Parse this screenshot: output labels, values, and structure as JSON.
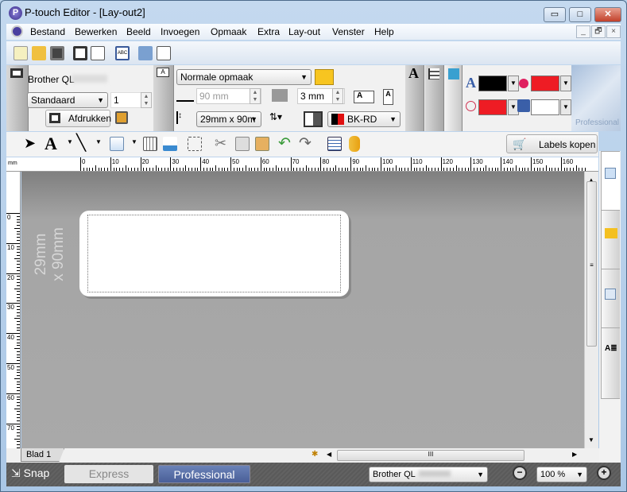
{
  "window": {
    "title": "P-touch Editor - [Lay-out2]",
    "minimize": "▭",
    "maximize": "□",
    "close": "✕"
  },
  "menu": {
    "items": [
      "Bestand",
      "Bewerken",
      "Beeld",
      "Invoegen",
      "Opmaak",
      "Extra",
      "Lay-out",
      "Venster",
      "Help"
    ],
    "mdi": [
      "_",
      "🗗",
      "×"
    ]
  },
  "toolbar": {
    "icons": [
      "new-layout-icon",
      "open-icon",
      "save-icon",
      "print-icon",
      "print-preview-icon",
      "text-label-icon",
      "database-icon",
      "transfer-icon"
    ]
  },
  "printer_panel": {
    "printer": "Brother QL",
    "mode": "Standaard",
    "copies": "1",
    "print_button": "Afdrukken"
  },
  "layout_panel": {
    "style": "Normale opmaak",
    "length": "90 mm",
    "margin": "3 mm",
    "tape_size": "29mm x 90m",
    "tape_color": "BK-RD"
  },
  "color_panel": {
    "text_color": "#000000",
    "fill_color": "#ee1c24",
    "line_color": "#ee1c24",
    "bg_color": "#ffffff",
    "brand": "Professional"
  },
  "draw_toolbar": {
    "icons": [
      "select-arrow-icon",
      "text-icon",
      "line-icon",
      "rectangle-icon",
      "table-icon",
      "barcode-icon",
      "arrange-icon",
      "cut-icon",
      "copy-icon",
      "paste-icon",
      "undo-icon",
      "redo-icon",
      "properties-icon",
      "database-icon"
    ],
    "buy_labels": "Labels kopen"
  },
  "ruler": {
    "unit": "mm",
    "h_ticks": [
      "0",
      "10",
      "20",
      "30",
      "40",
      "50",
      "60",
      "70",
      "80",
      "90",
      "100",
      "110",
      "120",
      "130",
      "140",
      "150",
      "160"
    ],
    "v_ticks": [
      "0",
      "10",
      "20",
      "30",
      "40",
      "50",
      "60",
      "70"
    ]
  },
  "canvas": {
    "size_line1": "29mm",
    "size_line2": "x 90mm"
  },
  "sheet_tab": "Blad 1",
  "hscroll_thumb": "III",
  "status": {
    "snap": "Snap",
    "express": "Express",
    "professional": "Professional",
    "printer": "Brother QL",
    "zoom": "100 %"
  }
}
